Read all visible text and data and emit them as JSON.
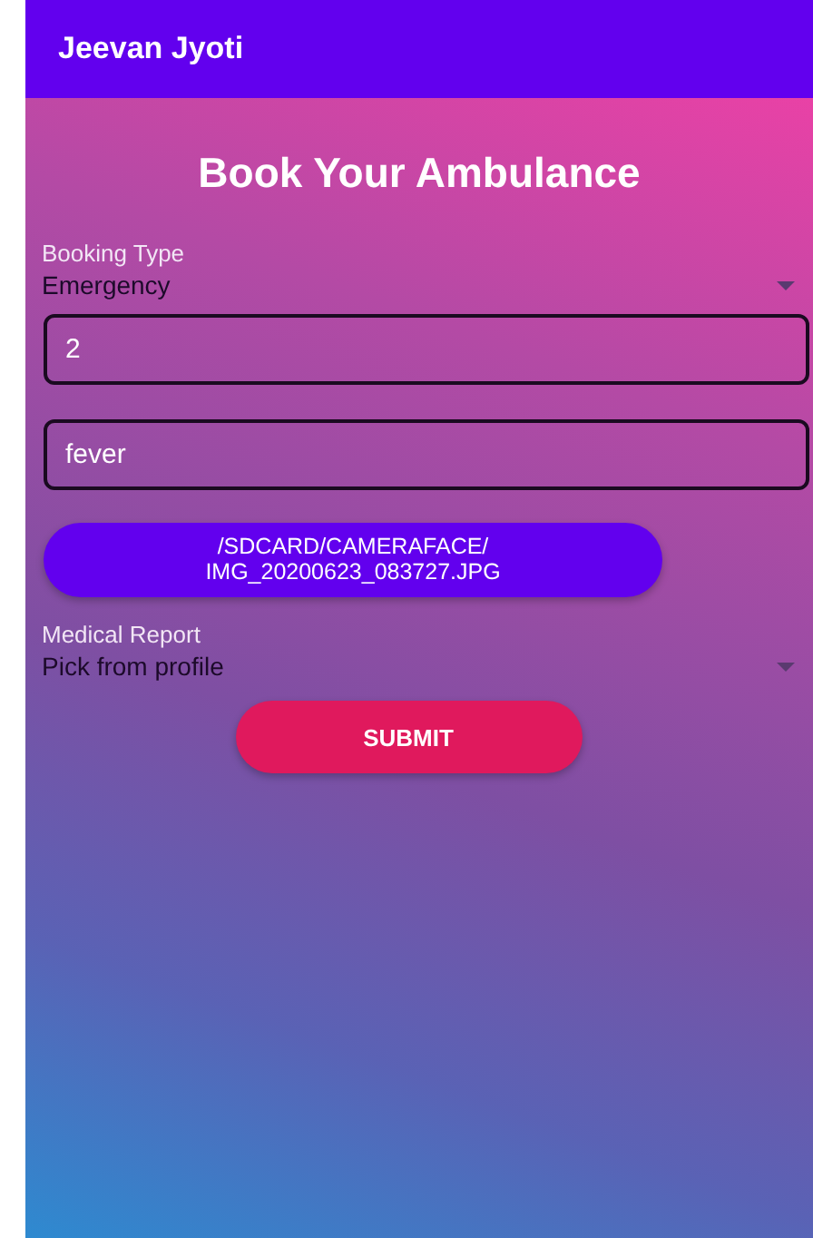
{
  "app_bar": {
    "title": "Jeevan Jyoti"
  },
  "heading": "Book Your Ambulance",
  "booking_type": {
    "label": "Booking Type",
    "value": "Emergency"
  },
  "fields": [
    {
      "value": "2"
    },
    {
      "value": "fever"
    }
  ],
  "file_button": {
    "label": "/SDCARD/CAMERAFACE/\nIMG_20200623_083727.JPG"
  },
  "medical_report": {
    "label": "Medical Report",
    "value": "Pick from profile"
  },
  "submit_button": {
    "label": "SUBMIT"
  }
}
